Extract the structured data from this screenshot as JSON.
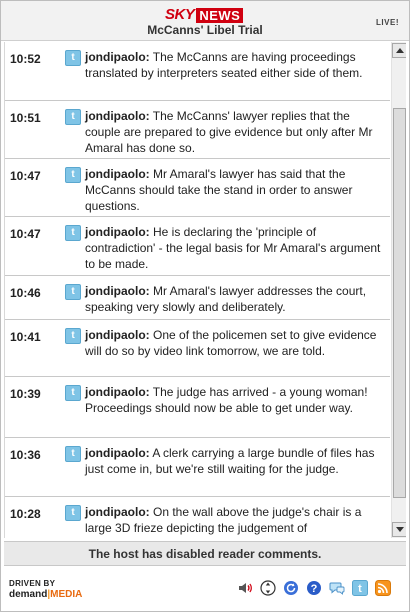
{
  "header": {
    "logo_sky": "SKY",
    "logo_news": "NEWS",
    "title": "McCanns' Libel Trial",
    "live": "LIVE!"
  },
  "entries": [
    {
      "time": "10:52",
      "author": "jondipaolo:",
      "text": "The McCanns are having proceedings translated by interpreters seated either side of them."
    },
    {
      "time": "10:51",
      "author": "jondipaolo:",
      "text": "The McCanns' lawyer replies that the couple are prepared to give evidence but only after Mr Amaral has done so."
    },
    {
      "time": "10:47",
      "author": "jondipaolo:",
      "text": "Mr Amaral's lawyer has said that the McCanns should take the stand in order to answer questions."
    },
    {
      "time": "10:47",
      "author": "jondipaolo:",
      "text": "He is declaring the 'principle of contradiction' - the legal basis for Mr Amaral's argument to be made."
    },
    {
      "time": "10:46",
      "author": "jondipaolo:",
      "text": "Mr Amaral's lawyer addresses the court, speaking very slowly and deliberately."
    },
    {
      "time": "10:41",
      "author": "jondipaolo:",
      "text": "One of the policemen set to give evidence will do so by video link tomorrow, we are told."
    },
    {
      "time": "10:39",
      "author": "jondipaolo:",
      "text": "The judge has arrived - a young woman! Proceedings should now be able to get under way."
    },
    {
      "time": "10:36",
      "author": "jondipaolo:",
      "text": "A clerk carrying a large bundle of files has just come in, but we're still waiting for the judge."
    },
    {
      "time": "10:28",
      "author": "jondipaolo:",
      "text": "On the wall above the judge's chair is a large 3D frieze depicting the judgement of"
    }
  ],
  "notice": "The host has disabled reader comments.",
  "footer": {
    "driven_by": "DRIVEN BY",
    "brand_demand": "demand",
    "brand_sep": "|",
    "brand_media": "MEDIA"
  },
  "toolbar_icons": [
    "speaker-icon",
    "scroll-mode-icon",
    "refresh-icon",
    "help-icon",
    "chat-icon",
    "twitter-icon",
    "rss-icon"
  ],
  "colors": {
    "brand_red": "#d00010",
    "twitter_blue": "#7fc4e6",
    "rss_orange": "#f7941d"
  }
}
